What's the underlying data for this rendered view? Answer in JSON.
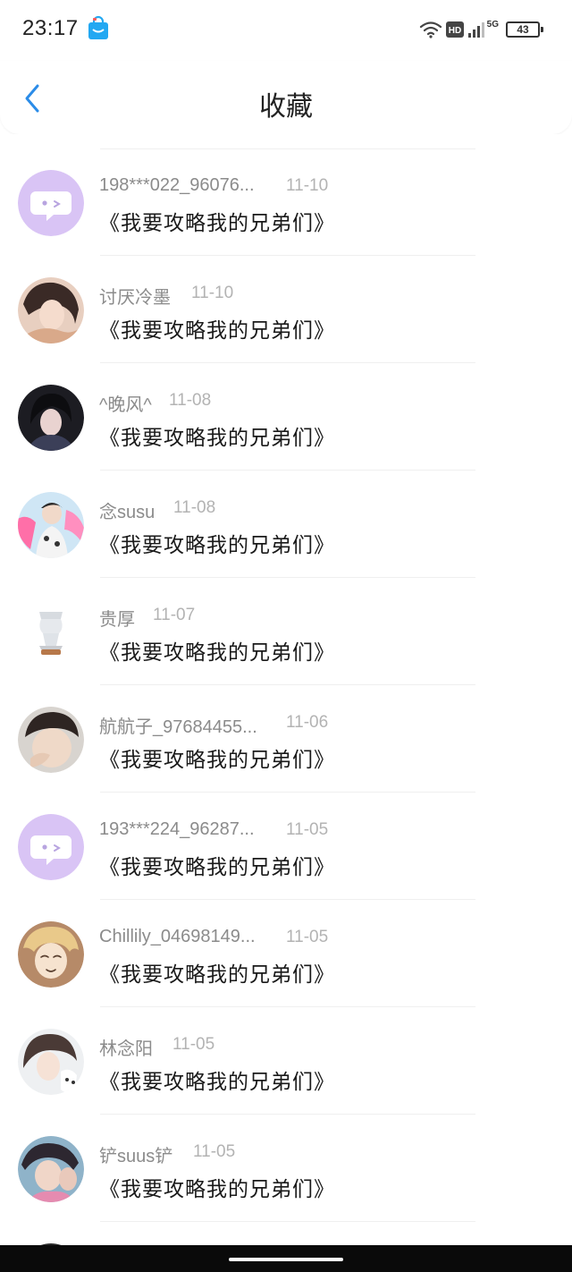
{
  "status_bar": {
    "time": "23:17",
    "app_icon": "shopping-bag-icon",
    "hd_label": "HD",
    "network": "5G",
    "battery": "43"
  },
  "header": {
    "title": "收藏",
    "back_icon": "chevron-left-icon",
    "accent_color": "#2b8ce8"
  },
  "items": [
    {
      "user": "198***022_96076...",
      "date": "11-10",
      "title": "《我要攻略我的兄弟们》",
      "avatar": "default-chat-avatar"
    },
    {
      "user": "讨厌冷墨",
      "date": "11-10",
      "title": "《我要攻略我的兄弟们》",
      "avatar": "user-photo-avatar"
    },
    {
      "user": "^晚风^",
      "date": "11-08",
      "title": "《我要攻略我的兄弟们》",
      "avatar": "user-photo-avatar"
    },
    {
      "user": "念susu",
      "date": "11-08",
      "title": "《我要攻略我的兄弟们》",
      "avatar": "user-photo-avatar"
    },
    {
      "user": "贵厚",
      "date": "11-07",
      "title": "《我要攻略我的兄弟们》",
      "avatar": "statue-avatar"
    },
    {
      "user": "航航子_97684455...",
      "date": "11-06",
      "title": "《我要攻略我的兄弟们》",
      "avatar": "user-photo-avatar"
    },
    {
      "user": "193***224_96287...",
      "date": "11-05",
      "title": "《我要攻略我的兄弟们》",
      "avatar": "default-chat-avatar"
    },
    {
      "user": "Chillily_04698149...",
      "date": "11-05",
      "title": "《我要攻略我的兄弟们》",
      "avatar": "anime-avatar"
    },
    {
      "user": "林念阳",
      "date": "11-05",
      "title": "《我要攻略我的兄弟们》",
      "avatar": "user-photo-avatar"
    },
    {
      "user": "铲suus铲",
      "date": "11-05",
      "title": "《我要攻略我的兄弟们》",
      "avatar": "user-photo-avatar"
    }
  ]
}
